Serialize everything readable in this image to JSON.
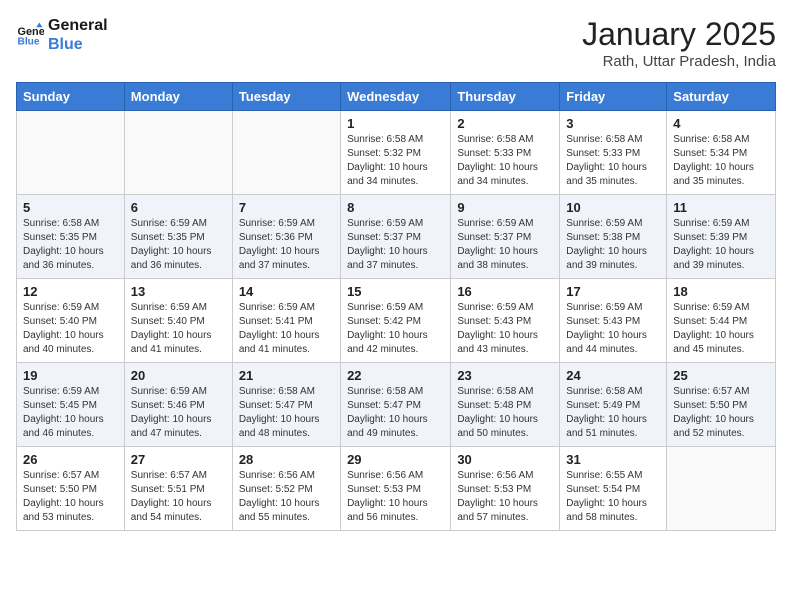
{
  "header": {
    "logo_line1": "General",
    "logo_line2": "Blue",
    "title": "January 2025",
    "subtitle": "Rath, Uttar Pradesh, India"
  },
  "weekdays": [
    "Sunday",
    "Monday",
    "Tuesday",
    "Wednesday",
    "Thursday",
    "Friday",
    "Saturday"
  ],
  "weeks": [
    [
      {
        "day": "",
        "sunrise": "",
        "sunset": "",
        "daylight": ""
      },
      {
        "day": "",
        "sunrise": "",
        "sunset": "",
        "daylight": ""
      },
      {
        "day": "",
        "sunrise": "",
        "sunset": "",
        "daylight": ""
      },
      {
        "day": "1",
        "sunrise": "Sunrise: 6:58 AM",
        "sunset": "Sunset: 5:32 PM",
        "daylight": "Daylight: 10 hours and 34 minutes."
      },
      {
        "day": "2",
        "sunrise": "Sunrise: 6:58 AM",
        "sunset": "Sunset: 5:33 PM",
        "daylight": "Daylight: 10 hours and 34 minutes."
      },
      {
        "day": "3",
        "sunrise": "Sunrise: 6:58 AM",
        "sunset": "Sunset: 5:33 PM",
        "daylight": "Daylight: 10 hours and 35 minutes."
      },
      {
        "day": "4",
        "sunrise": "Sunrise: 6:58 AM",
        "sunset": "Sunset: 5:34 PM",
        "daylight": "Daylight: 10 hours and 35 minutes."
      }
    ],
    [
      {
        "day": "5",
        "sunrise": "Sunrise: 6:58 AM",
        "sunset": "Sunset: 5:35 PM",
        "daylight": "Daylight: 10 hours and 36 minutes."
      },
      {
        "day": "6",
        "sunrise": "Sunrise: 6:59 AM",
        "sunset": "Sunset: 5:35 PM",
        "daylight": "Daylight: 10 hours and 36 minutes."
      },
      {
        "day": "7",
        "sunrise": "Sunrise: 6:59 AM",
        "sunset": "Sunset: 5:36 PM",
        "daylight": "Daylight: 10 hours and 37 minutes."
      },
      {
        "day": "8",
        "sunrise": "Sunrise: 6:59 AM",
        "sunset": "Sunset: 5:37 PM",
        "daylight": "Daylight: 10 hours and 37 minutes."
      },
      {
        "day": "9",
        "sunrise": "Sunrise: 6:59 AM",
        "sunset": "Sunset: 5:37 PM",
        "daylight": "Daylight: 10 hours and 38 minutes."
      },
      {
        "day": "10",
        "sunrise": "Sunrise: 6:59 AM",
        "sunset": "Sunset: 5:38 PM",
        "daylight": "Daylight: 10 hours and 39 minutes."
      },
      {
        "day": "11",
        "sunrise": "Sunrise: 6:59 AM",
        "sunset": "Sunset: 5:39 PM",
        "daylight": "Daylight: 10 hours and 39 minutes."
      }
    ],
    [
      {
        "day": "12",
        "sunrise": "Sunrise: 6:59 AM",
        "sunset": "Sunset: 5:40 PM",
        "daylight": "Daylight: 10 hours and 40 minutes."
      },
      {
        "day": "13",
        "sunrise": "Sunrise: 6:59 AM",
        "sunset": "Sunset: 5:40 PM",
        "daylight": "Daylight: 10 hours and 41 minutes."
      },
      {
        "day": "14",
        "sunrise": "Sunrise: 6:59 AM",
        "sunset": "Sunset: 5:41 PM",
        "daylight": "Daylight: 10 hours and 41 minutes."
      },
      {
        "day": "15",
        "sunrise": "Sunrise: 6:59 AM",
        "sunset": "Sunset: 5:42 PM",
        "daylight": "Daylight: 10 hours and 42 minutes."
      },
      {
        "day": "16",
        "sunrise": "Sunrise: 6:59 AM",
        "sunset": "Sunset: 5:43 PM",
        "daylight": "Daylight: 10 hours and 43 minutes."
      },
      {
        "day": "17",
        "sunrise": "Sunrise: 6:59 AM",
        "sunset": "Sunset: 5:43 PM",
        "daylight": "Daylight: 10 hours and 44 minutes."
      },
      {
        "day": "18",
        "sunrise": "Sunrise: 6:59 AM",
        "sunset": "Sunset: 5:44 PM",
        "daylight": "Daylight: 10 hours and 45 minutes."
      }
    ],
    [
      {
        "day": "19",
        "sunrise": "Sunrise: 6:59 AM",
        "sunset": "Sunset: 5:45 PM",
        "daylight": "Daylight: 10 hours and 46 minutes."
      },
      {
        "day": "20",
        "sunrise": "Sunrise: 6:59 AM",
        "sunset": "Sunset: 5:46 PM",
        "daylight": "Daylight: 10 hours and 47 minutes."
      },
      {
        "day": "21",
        "sunrise": "Sunrise: 6:58 AM",
        "sunset": "Sunset: 5:47 PM",
        "daylight": "Daylight: 10 hours and 48 minutes."
      },
      {
        "day": "22",
        "sunrise": "Sunrise: 6:58 AM",
        "sunset": "Sunset: 5:47 PM",
        "daylight": "Daylight: 10 hours and 49 minutes."
      },
      {
        "day": "23",
        "sunrise": "Sunrise: 6:58 AM",
        "sunset": "Sunset: 5:48 PM",
        "daylight": "Daylight: 10 hours and 50 minutes."
      },
      {
        "day": "24",
        "sunrise": "Sunrise: 6:58 AM",
        "sunset": "Sunset: 5:49 PM",
        "daylight": "Daylight: 10 hours and 51 minutes."
      },
      {
        "day": "25",
        "sunrise": "Sunrise: 6:57 AM",
        "sunset": "Sunset: 5:50 PM",
        "daylight": "Daylight: 10 hours and 52 minutes."
      }
    ],
    [
      {
        "day": "26",
        "sunrise": "Sunrise: 6:57 AM",
        "sunset": "Sunset: 5:50 PM",
        "daylight": "Daylight: 10 hours and 53 minutes."
      },
      {
        "day": "27",
        "sunrise": "Sunrise: 6:57 AM",
        "sunset": "Sunset: 5:51 PM",
        "daylight": "Daylight: 10 hours and 54 minutes."
      },
      {
        "day": "28",
        "sunrise": "Sunrise: 6:56 AM",
        "sunset": "Sunset: 5:52 PM",
        "daylight": "Daylight: 10 hours and 55 minutes."
      },
      {
        "day": "29",
        "sunrise": "Sunrise: 6:56 AM",
        "sunset": "Sunset: 5:53 PM",
        "daylight": "Daylight: 10 hours and 56 minutes."
      },
      {
        "day": "30",
        "sunrise": "Sunrise: 6:56 AM",
        "sunset": "Sunset: 5:53 PM",
        "daylight": "Daylight: 10 hours and 57 minutes."
      },
      {
        "day": "31",
        "sunrise": "Sunrise: 6:55 AM",
        "sunset": "Sunset: 5:54 PM",
        "daylight": "Daylight: 10 hours and 58 minutes."
      },
      {
        "day": "",
        "sunrise": "",
        "sunset": "",
        "daylight": ""
      }
    ]
  ]
}
